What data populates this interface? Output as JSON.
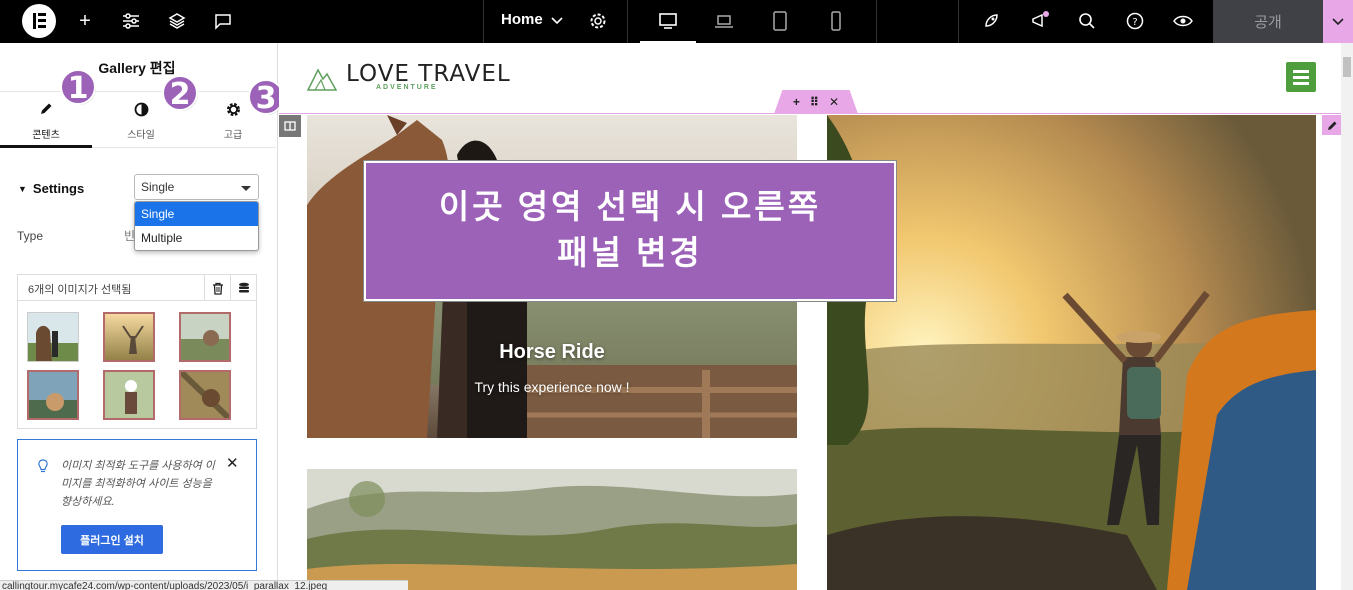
{
  "topbar": {
    "home_label": "Home",
    "publish_label": "공개",
    "icons": [
      "elementor-logo-icon",
      "plus-icon",
      "sliders-icon",
      "layers-icon",
      "comment-icon",
      "chevron-down-icon",
      "gear-icon",
      "desktop-icon",
      "laptop-icon",
      "tablet-icon",
      "mobile-icon",
      "rocket-icon",
      "megaphone-icon",
      "search-icon",
      "help-icon",
      "eye-icon"
    ]
  },
  "panel": {
    "title": "Gallery 편집",
    "tabs": [
      {
        "label": "콘텐츠",
        "icon": "pencil-icon",
        "number": "1"
      },
      {
        "label": "스타일",
        "icon": "contrast-icon",
        "number": "2"
      },
      {
        "label": "고급",
        "icon": "gear-icon",
        "number": "3"
      }
    ],
    "settings_heading": "Settings",
    "gallery_type_selected": "Single",
    "gallery_type_options": [
      "Single",
      "Multiple"
    ],
    "type_label": "Type",
    "type_value_partial": "빈",
    "gallery_header": "6개의 이미지가 선택됨",
    "notice_text": "이미지 최적화 도구를 사용하여 이미지를 최적화하여 사이트 성능을 향상하세요.",
    "notice_button": "플러그인 설치",
    "status_url": "callingtour.mycafe24.com/wp-content/uploads/2023/05/i_parallax_12.jpeg"
  },
  "canvas": {
    "brand_name": "LOVE TRAVEL",
    "brand_sub": "ADVENTURE",
    "card_title": "Horse Ride",
    "card_subtitle": "Try this experience now !",
    "callout_line1": "이곳 영역 선택 시 오른쪽",
    "callout_line2": "패널 변경"
  },
  "colors": {
    "accent_purple": "#9b62b8",
    "elementor_pink": "#e8a8e8",
    "primary_blue": "#2e6be0",
    "brand_green": "#4e9e3d"
  }
}
